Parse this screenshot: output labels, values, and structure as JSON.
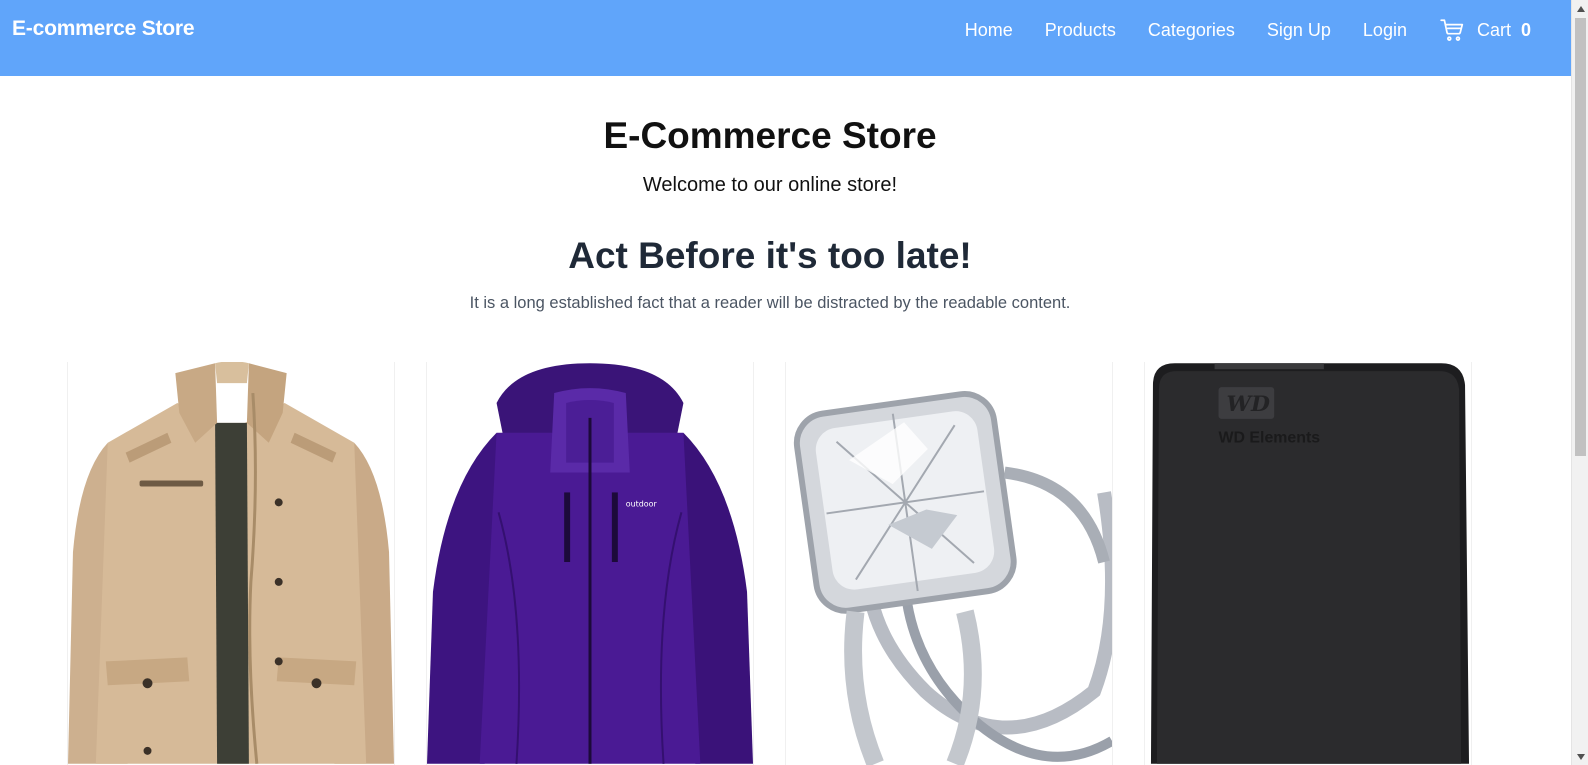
{
  "navbar": {
    "brand": "E-commerce Store",
    "links": [
      "Home",
      "Products",
      "Categories",
      "Sign Up",
      "Login"
    ],
    "cart_label": "Cart",
    "cart_count": "0",
    "cart_icon": "shopping-cart-icon",
    "color": "#60a5fa"
  },
  "hero": {
    "title": "E-Commerce Store",
    "subtitle": "Welcome to our online store!"
  },
  "promo": {
    "title": "Act Before it's too late!",
    "text": "It is a long established fact that a reader will be distracted by the readable content."
  },
  "products": [
    {
      "image": "beige-jacket-image"
    },
    {
      "image": "purple-jacket-image",
      "brand_text": "outdoor"
    },
    {
      "image": "diamond-ring-image"
    },
    {
      "image": "hard-drive-image",
      "brand_text": "WD Elements",
      "logo_text": "WD"
    }
  ]
}
